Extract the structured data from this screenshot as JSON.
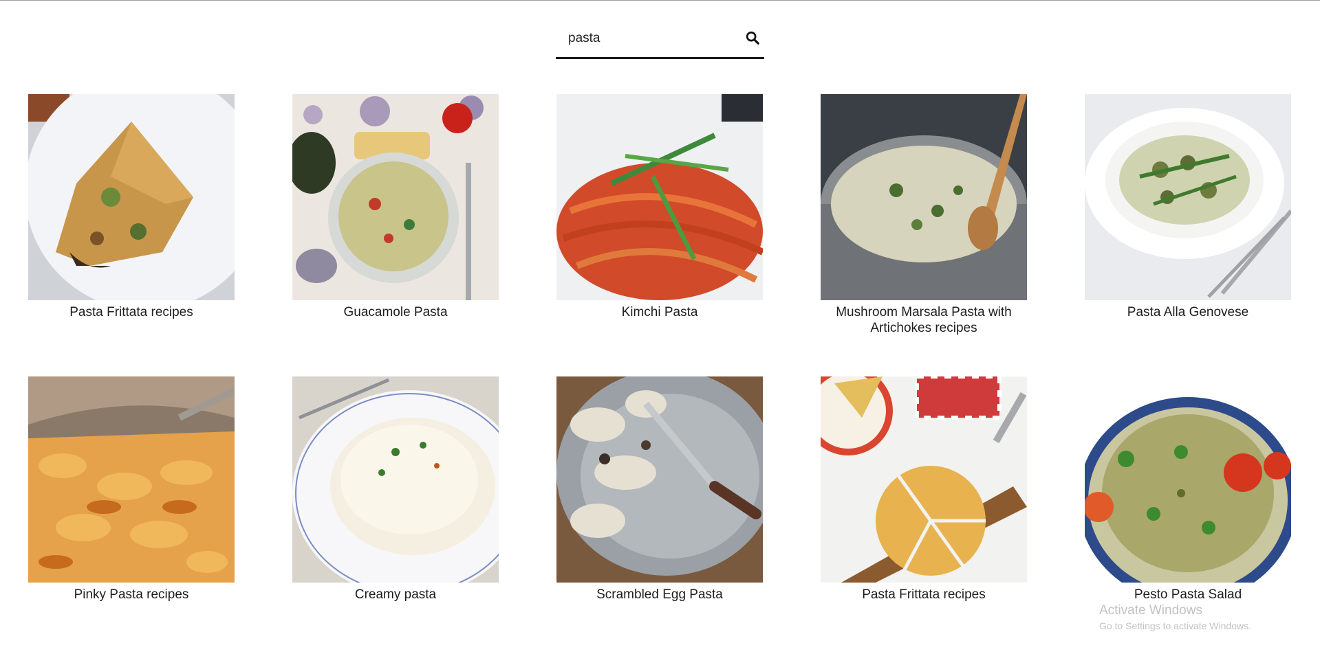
{
  "search": {
    "value": "pasta",
    "icon": "search-icon"
  },
  "recipes": [
    {
      "title": "Pasta Frittata recipes"
    },
    {
      "title": "Guacamole Pasta"
    },
    {
      "title": "Kimchi Pasta"
    },
    {
      "title": "Mushroom Marsala Pasta with Artichokes recipes"
    },
    {
      "title": "Pasta Alla Genovese"
    },
    {
      "title": "Pinky Pasta recipes"
    },
    {
      "title": "Creamy pasta"
    },
    {
      "title": "Scrambled Egg Pasta"
    },
    {
      "title": "Pasta Frittata recipes"
    },
    {
      "title": "Pesto Pasta Salad"
    }
  ],
  "watermark": {
    "title": "Activate Windows",
    "subtitle": "Go to Settings to activate Windows."
  }
}
